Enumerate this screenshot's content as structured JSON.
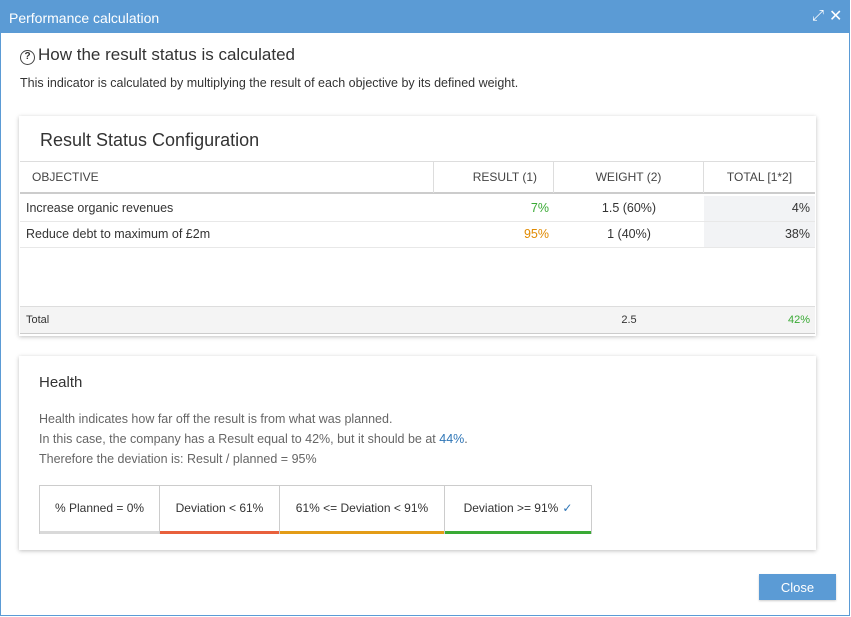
{
  "window": {
    "title": "Performance calculation"
  },
  "heading": "How the result status is calculated",
  "intro": "This indicator is calculated by multiplying the result of each objective by its defined weight.",
  "config": {
    "title": "Result Status Configuration",
    "columns": [
      "OBJECTIVE",
      "RESULT (1)",
      "WEIGHT (2)",
      "TOTAL [1*2]"
    ],
    "rows": [
      {
        "objective": "Increase organic revenues",
        "result": "7%",
        "weight": "1.5 (60%)",
        "total": "4%"
      },
      {
        "objective": "Reduce debt to maximum of £2m",
        "result": "95%",
        "weight": "1 (40%)",
        "total": "38%"
      }
    ],
    "total": {
      "label": "Total",
      "weight": "2.5",
      "total": "42%"
    }
  },
  "health": {
    "title": "Health",
    "line1": "Health indicates how far off the result is from what was planned.",
    "line2_prefix": "In this case, the company has a Result equal to 42%, but it should be at ",
    "line2_link": "44%",
    "line2_suffix": ".",
    "line3": "Therefore the deviation is: Result / planned = 95%",
    "segments": [
      {
        "label": "% Planned = 0%"
      },
      {
        "label": "Deviation < 61%"
      },
      {
        "label": "61% <= Deviation < 91%"
      },
      {
        "label": "Deviation >= 91%",
        "checked": true
      }
    ]
  },
  "buttons": {
    "close": "Close"
  },
  "colors": {
    "accent": "#5b9bd5",
    "green": "#3aaa35",
    "orange": "#e08a00",
    "red": "#e8603c",
    "link": "#2e75b6"
  }
}
